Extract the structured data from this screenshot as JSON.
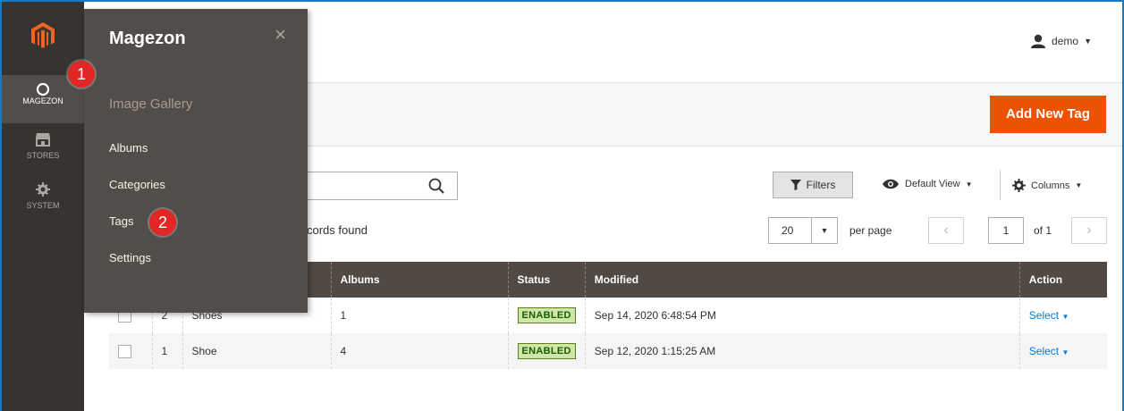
{
  "nav": {
    "items": [
      {
        "label": "MAGEZON",
        "icon": "magezon-ring-icon"
      },
      {
        "label": "STORES",
        "icon": "store-icon"
      },
      {
        "label": "SYSTEM",
        "icon": "gear-icon"
      }
    ]
  },
  "flyout": {
    "title": "Magezon",
    "close": "×",
    "section": "Image Gallery",
    "items": [
      "Albums",
      "Categories",
      "Tags",
      "Settings"
    ]
  },
  "badges": [
    "1",
    "2"
  ],
  "header": {
    "user": "demo",
    "add_button": "Add New Tag"
  },
  "toolbar": {
    "filters": "Filters",
    "default_view": "Default View",
    "columns": "Columns",
    "records_fragment": "cords found",
    "per_page_value": "20",
    "per_page_label": "per page",
    "current_page": "1",
    "of_pages": "of 1"
  },
  "table": {
    "columns": [
      "Albums",
      "Status",
      "Modified",
      "Action"
    ],
    "rows": [
      {
        "id": "2",
        "name": "Shoes",
        "albums": "1",
        "status": "ENABLED",
        "modified": "Sep 14, 2020 6:48:54 PM",
        "action": "Select"
      },
      {
        "id": "1",
        "name": "Shoe",
        "albums": "4",
        "status": "ENABLED",
        "modified": "Sep 12, 2020 1:15:25 AM",
        "action": "Select"
      }
    ]
  },
  "colors": {
    "accent": "#eb5202",
    "nav_bg": "#373330",
    "flyout_bg": "#524d49",
    "badge": "#e22626",
    "header_bg": "#514943"
  }
}
